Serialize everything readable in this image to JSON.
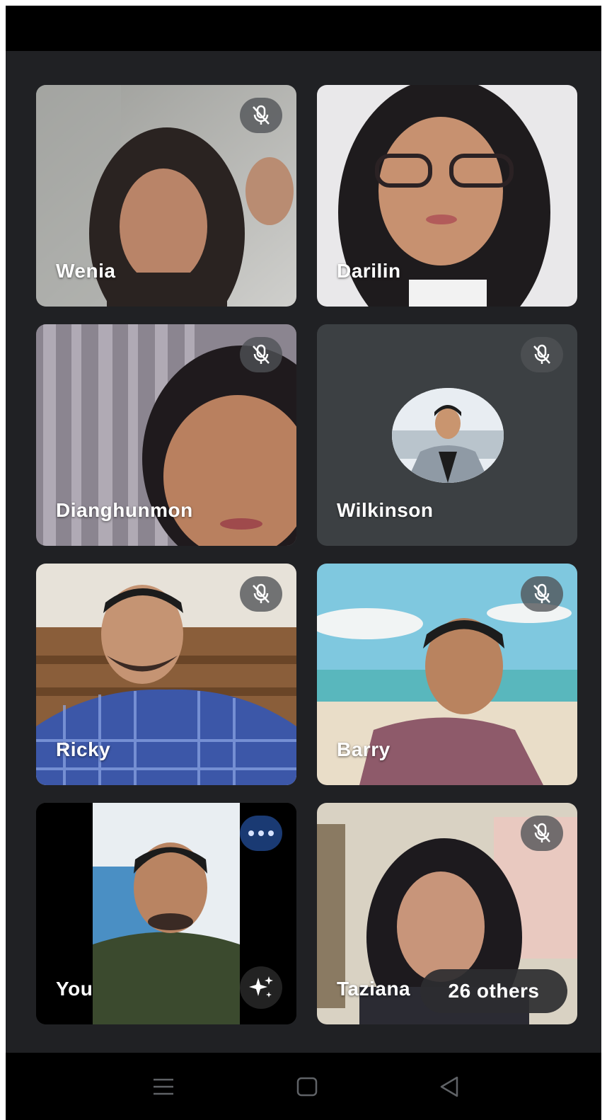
{
  "participants": [
    {
      "name": "Wenia",
      "muted": true
    },
    {
      "name": "Darilin",
      "muted": false
    },
    {
      "name": "Dianghunmon",
      "muted": true
    },
    {
      "name": "Wilkinson",
      "muted": true
    },
    {
      "name": "Ricky",
      "muted": true
    },
    {
      "name": "Barry",
      "muted": true
    },
    {
      "name": "You",
      "muted": false
    },
    {
      "name": "Taziana",
      "muted": true
    }
  ],
  "others_label": "26 others",
  "icons": {
    "muted": "mic-off-icon",
    "more": "more-options-icon",
    "effects": "sparkle-effects-icon",
    "nav": [
      "menu-icon",
      "home-square-icon",
      "back-triangle-icon"
    ]
  },
  "colors": {
    "background": "#202124",
    "more_button": "#1a3a73",
    "badge": "#505256"
  }
}
